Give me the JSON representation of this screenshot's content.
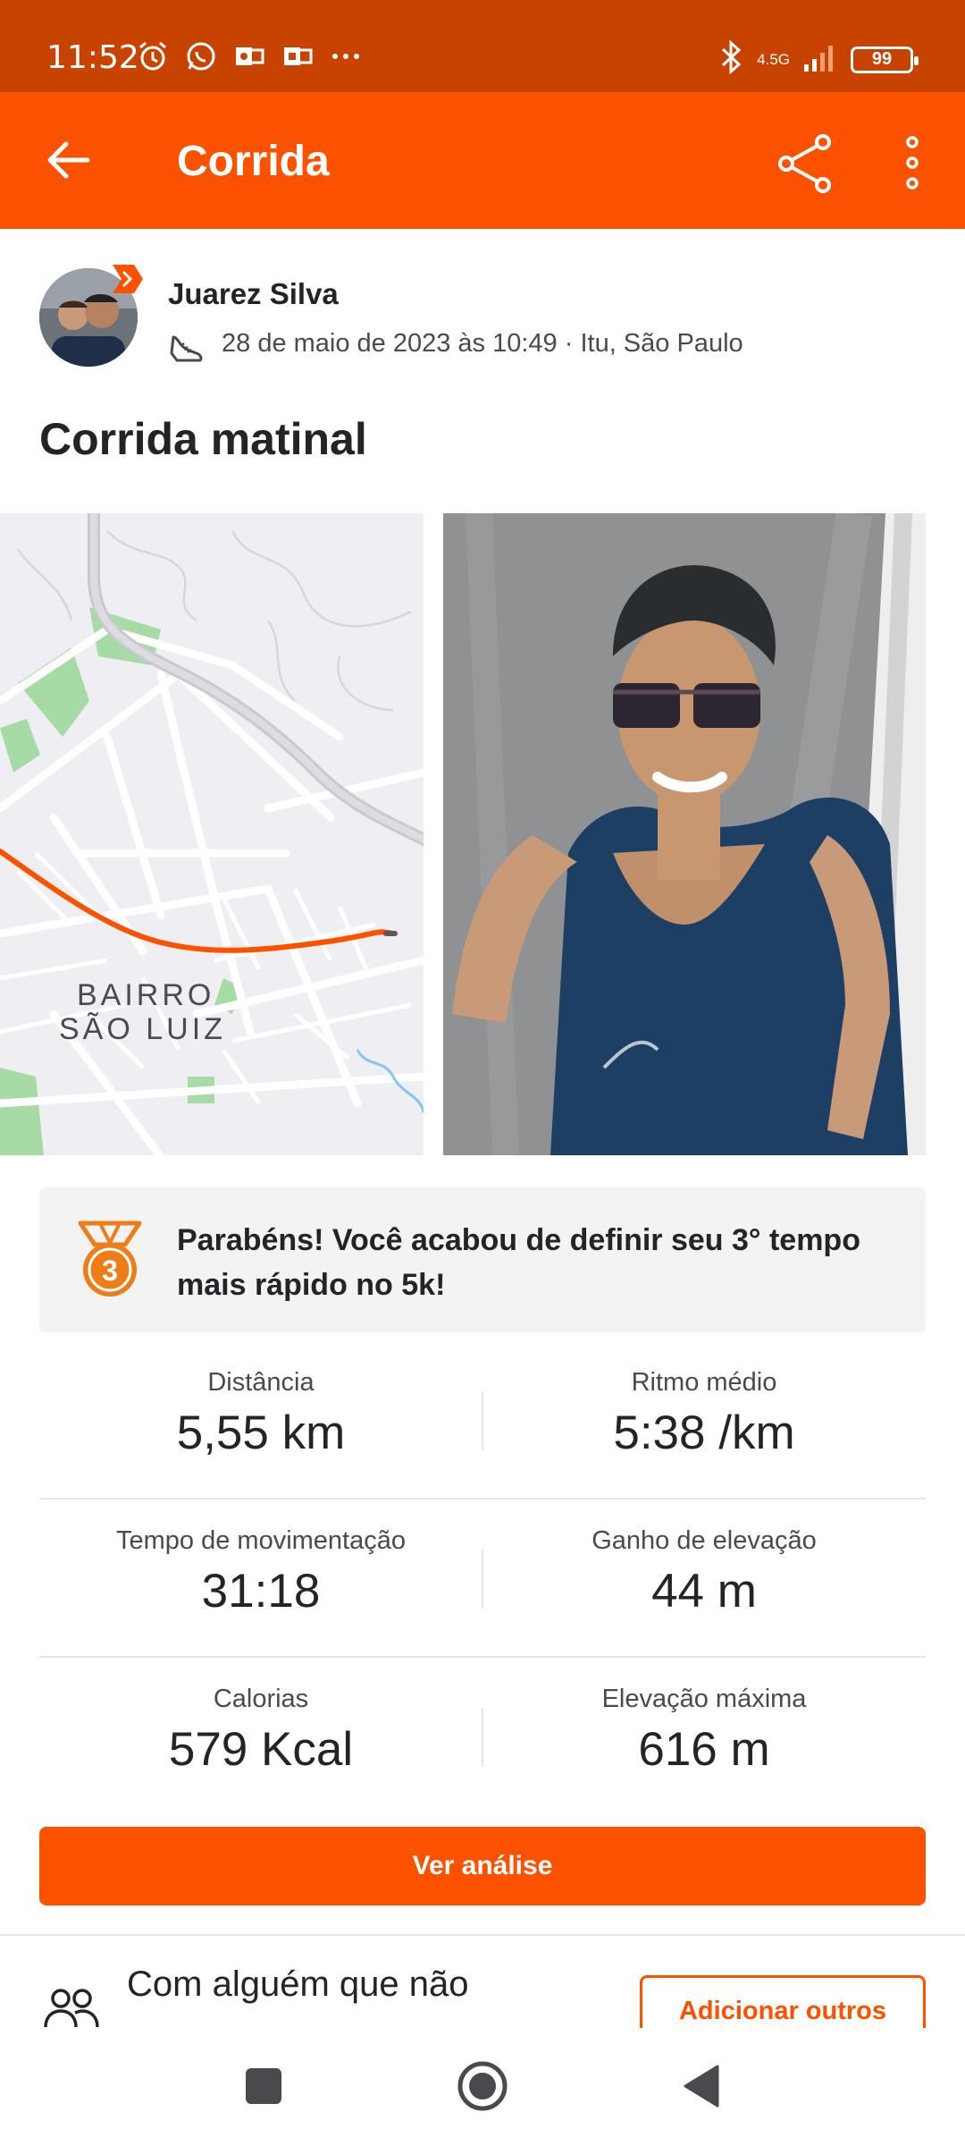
{
  "status_bar": {
    "time": "11:52",
    "network": "4.5G",
    "battery": "99"
  },
  "app_bar": {
    "title": "Corrida"
  },
  "athlete": {
    "name": "Juarez Silva",
    "meta": "28 de maio de 2023 às 10:49 · Itu, São Paulo"
  },
  "activity": {
    "title": "Corrida matinal"
  },
  "map": {
    "label_line1": "BAIRRO",
    "label_line2": "SÃO LUIZ",
    "route_color": "#fc5200"
  },
  "achievement": {
    "medal_number": "3",
    "text": "Parabéns! Você acabou de definir seu 3° tempo mais rápido no 5k!"
  },
  "stats": [
    {
      "left_label": "Distância",
      "left_value": "5,55 km",
      "right_label": "Ritmo médio",
      "right_value": "5:38 /km"
    },
    {
      "left_label": "Tempo de movimentação",
      "left_value": "31:18",
      "right_label": "Ganho de elevação",
      "right_value": "44 m"
    },
    {
      "left_label": "Calorias",
      "left_value": "579 Kcal",
      "right_label": "Elevação máxima",
      "right_value": "616 m"
    }
  ],
  "cta": {
    "label": "Ver análise"
  },
  "tag": {
    "text": "Com alguém que não",
    "button_label": "Adicionar outros"
  },
  "colors": {
    "brand": "#fc5200",
    "status_bar": "#c84300"
  }
}
